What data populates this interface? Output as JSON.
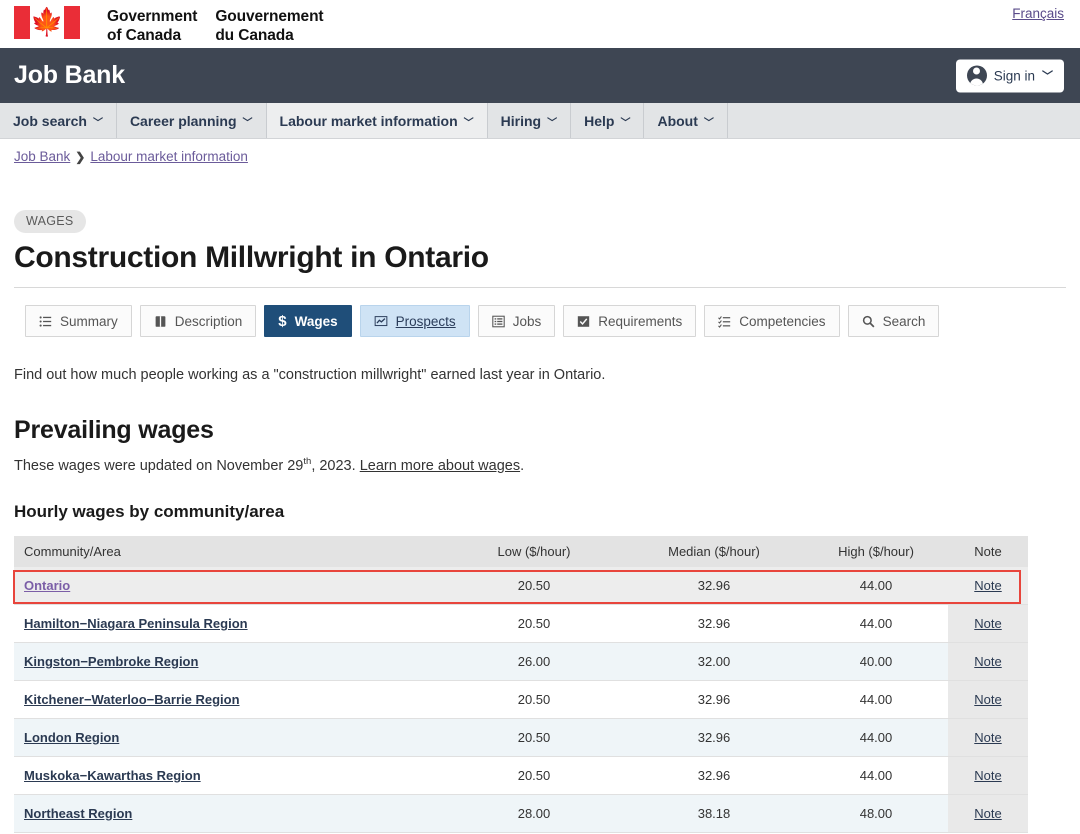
{
  "goc": {
    "flag_icon": "canada-flag-icon",
    "wordmark_en_line1": "Government",
    "wordmark_en_line2": "of Canada",
    "wordmark_fr_line1": "Gouvernement",
    "wordmark_fr_line2": "du Canada",
    "language_link": "Français"
  },
  "jobbank": {
    "title": "Job Bank",
    "signin_label": "Sign in",
    "signin_icon": "user-avatar-icon",
    "signin_caret": "❯"
  },
  "nav": {
    "items": [
      {
        "label": "Job search",
        "caret": "❯",
        "active": false
      },
      {
        "label": "Career planning",
        "caret": "❯",
        "active": false
      },
      {
        "label": "Labour market information",
        "caret": "❯",
        "active": true
      },
      {
        "label": "Hiring",
        "caret": "❯",
        "active": false
      },
      {
        "label": "Help",
        "caret": "❯",
        "active": false
      },
      {
        "label": "About",
        "caret": "❯",
        "active": false
      }
    ]
  },
  "breadcrumb": {
    "home": "Job Bank",
    "separator": "❯",
    "current": "Labour market information"
  },
  "page": {
    "badge": "WAGES",
    "title": "Construction Millwright in Ontario",
    "intro": "Find out how much people working as a \"construction millwright\" earned last year in Ontario.",
    "section_title": "Prevailing wages",
    "updated_prefix": "These wages were updated on November 29",
    "updated_sup": "th",
    "updated_suffix": ", 2023. ",
    "updated_link": "Learn more about wages",
    "updated_period": ".",
    "table_title": "Hourly wages by community/area"
  },
  "tabs": [
    {
      "label": "Summary",
      "icon": "list-icon",
      "glyph": "☰",
      "state": "normal"
    },
    {
      "label": "Description",
      "icon": "book-icon",
      "glyph": "▤",
      "state": "normal"
    },
    {
      "label": "Wages",
      "icon": "dollar-icon",
      "glyph": "$",
      "state": "active"
    },
    {
      "label": "Prospects",
      "icon": "chart-line-icon",
      "glyph": "▰",
      "state": "hover"
    },
    {
      "label": "Jobs",
      "icon": "list-panel-icon",
      "glyph": "▤",
      "state": "normal"
    },
    {
      "label": "Requirements",
      "icon": "checkbox-icon",
      "glyph": "☑",
      "state": "normal"
    },
    {
      "label": "Competencies",
      "icon": "checklist-icon",
      "glyph": "☷",
      "state": "normal"
    },
    {
      "label": "Search",
      "icon": "search-icon",
      "glyph": "⚲",
      "state": "normal"
    }
  ],
  "table": {
    "headers": [
      "Community/Area",
      "Low ($/hour)",
      "Median ($/hour)",
      "High ($/hour)",
      "Note"
    ],
    "note_label": "Note",
    "rows": [
      {
        "area": "Ontario",
        "low": "20.50",
        "median": "32.96",
        "high": "44.00",
        "note": "Note",
        "highlighted": true
      },
      {
        "area": "Hamilton−Niagara Peninsula Region",
        "low": "20.50",
        "median": "32.96",
        "high": "44.00",
        "note": "Note",
        "highlighted": false
      },
      {
        "area": "Kingston−Pembroke Region",
        "low": "26.00",
        "median": "32.00",
        "high": "40.00",
        "note": "Note",
        "highlighted": false
      },
      {
        "area": "Kitchener−Waterloo−Barrie Region",
        "low": "20.50",
        "median": "32.96",
        "high": "44.00",
        "note": "Note",
        "highlighted": false
      },
      {
        "area": "London Region",
        "low": "20.50",
        "median": "32.96",
        "high": "44.00",
        "note": "Note",
        "highlighted": false
      },
      {
        "area": "Muskoka−Kawarthas Region",
        "low": "20.50",
        "median": "32.96",
        "high": "44.00",
        "note": "Note",
        "highlighted": false
      },
      {
        "area": "Northeast Region",
        "low": "28.00",
        "median": "38.18",
        "high": "48.00",
        "note": "Note",
        "highlighted": false
      }
    ]
  },
  "colors": {
    "flag_red": "#EA2D37",
    "jobbank_bar": "#3E4653",
    "nav_bg": "#E2E4E6",
    "tab_active": "#1F4E79",
    "tab_hover": "#CFE3F5",
    "selection_red": "#E8453C",
    "link_visited": "#7B5EA7",
    "link_navy": "#2B3A52",
    "row_alt": "#EFF5F8",
    "note_col_bg": "#E9E9E9"
  }
}
